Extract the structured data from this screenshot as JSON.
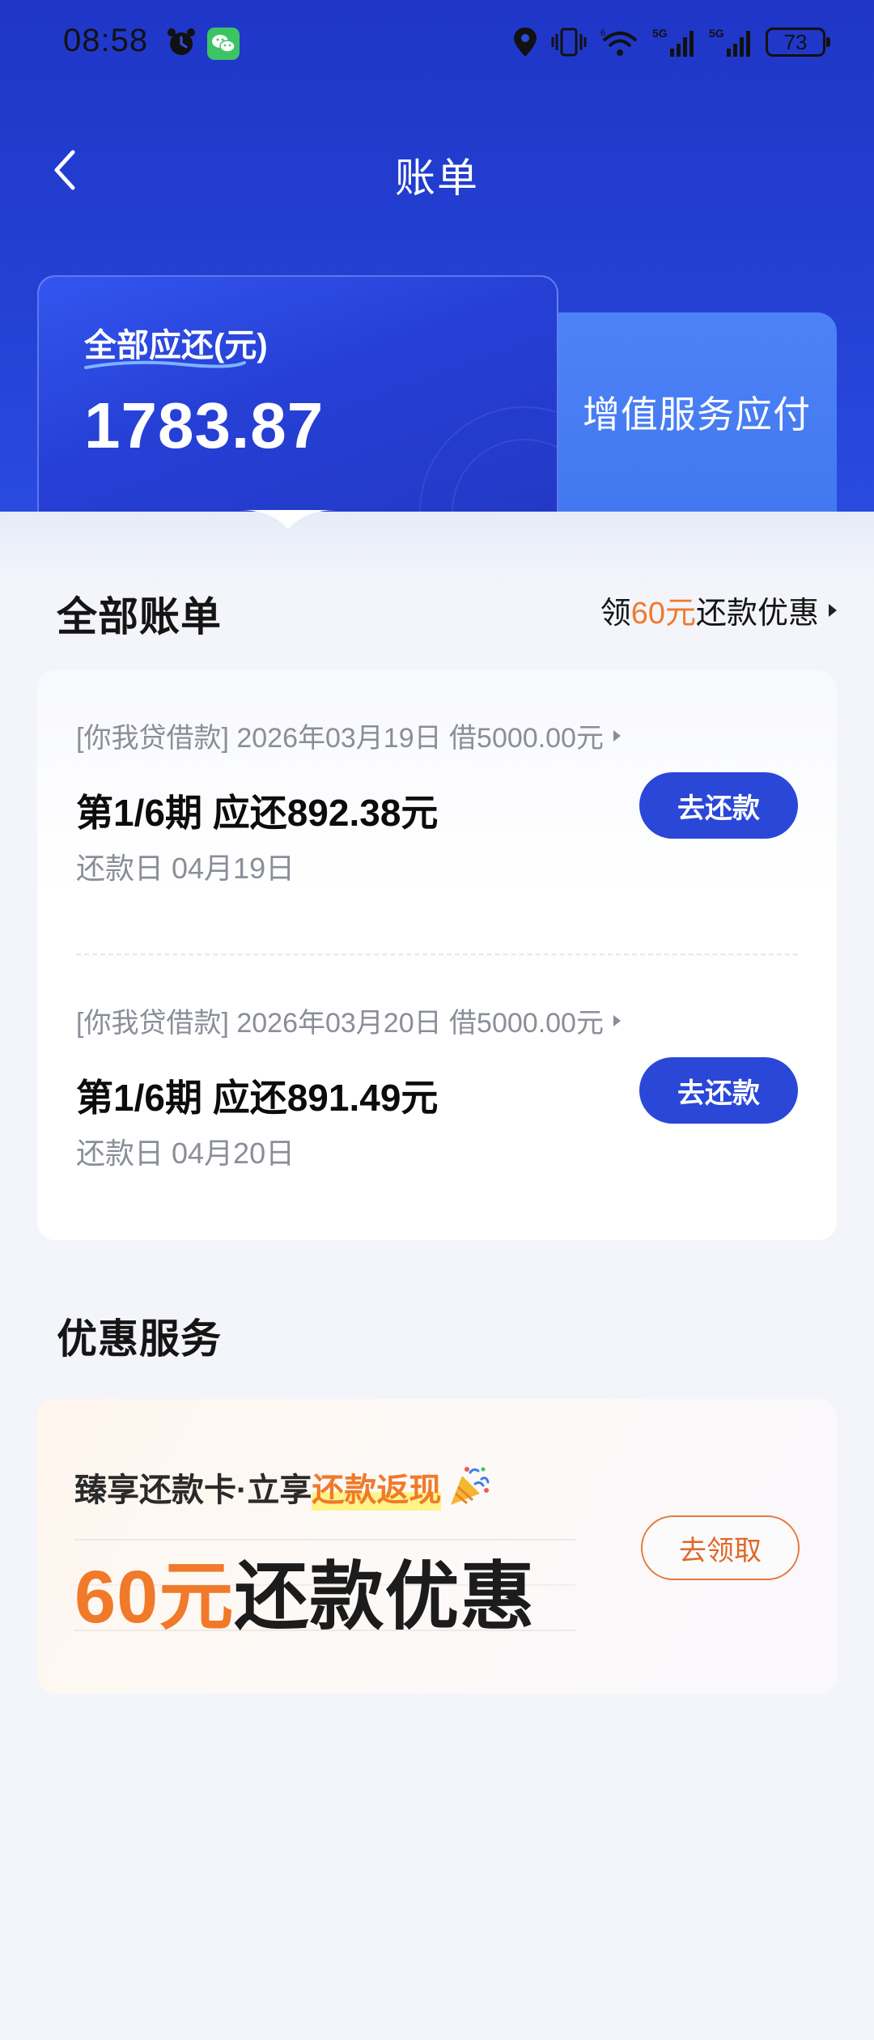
{
  "status_bar": {
    "time": "08:58",
    "battery": "73",
    "icons": [
      "alarm-icon",
      "wechat-icon",
      "location-icon",
      "vibrate-icon",
      "wifi-icon",
      "5g-signal-icon",
      "5g-signal-icon",
      "battery-icon"
    ]
  },
  "nav": {
    "title": "账单"
  },
  "tabs": {
    "main_label": "全部应还(元)",
    "main_amount": "1783.87",
    "side_label": "增值服务应付"
  },
  "bills_section": {
    "title": "全部账单",
    "promo_prefix": "领",
    "promo_highlight": "60元",
    "promo_suffix": "还款优惠"
  },
  "bills": [
    {
      "meta": "[你我贷借款] 2026年03月19日 借5000.00元",
      "amount": "第1/6期 应还892.38元",
      "due": "还款日 04月19日",
      "button": "去还款"
    },
    {
      "meta": "[你我贷借款] 2026年03月20日 借5000.00元",
      "amount": "第1/6期 应还891.49元",
      "due": "还款日 04月20日",
      "button": "去还款"
    }
  ],
  "services_section": {
    "title": "优惠服务"
  },
  "promo_card": {
    "sub_prefix": "臻享还款卡·立享",
    "sub_highlight": "还款返现",
    "main_highlight": "60元",
    "main_suffix": "还款优惠",
    "button": "去领取"
  },
  "colors": {
    "header_blue": "#2340d2",
    "button_blue": "#2a47d8",
    "accent_orange": "#f07a2a"
  }
}
